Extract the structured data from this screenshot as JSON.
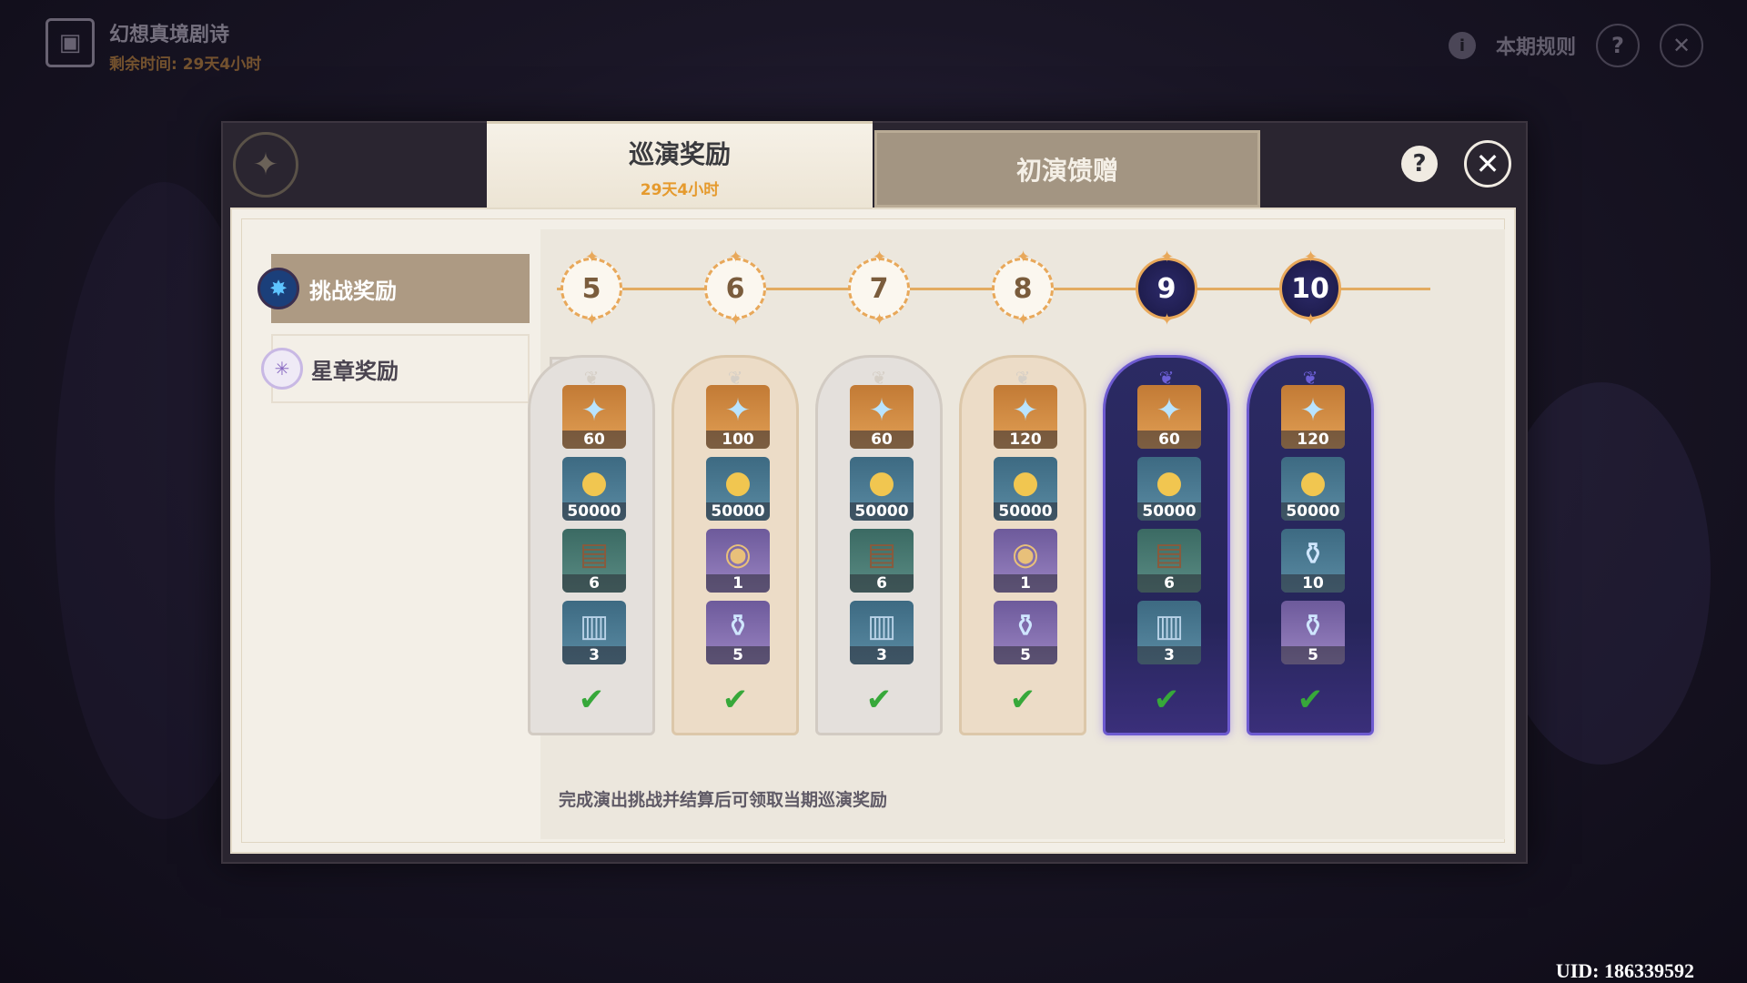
{
  "top_left": {
    "title": "幻想真境剧诗",
    "remaining": "剩余时间: 29天4小时"
  },
  "top_right": {
    "rules_label": "本期规则",
    "info_icon": "i",
    "help_icon": "?",
    "close_icon": "✕"
  },
  "tabs": [
    {
      "label": "巡演奖励",
      "sub": "29天4小时"
    },
    {
      "label": "初演馈赠"
    }
  ],
  "header": {
    "help_icon": "?",
    "close_icon": "✕"
  },
  "sidebar": {
    "items": [
      {
        "label": "挑战奖励",
        "icon": "star-badge-icon"
      },
      {
        "label": "星章奖励",
        "icon": "sparkle-badge-icon"
      }
    ]
  },
  "stages": [
    {
      "num": "5",
      "style": "gray",
      "claimed": true,
      "items": [
        {
          "icon": "crystal-icon",
          "count": "60",
          "bg": "orange"
        },
        {
          "icon": "mora-coin-icon",
          "count": "50000",
          "bg": "teal"
        },
        {
          "icon": "book-icon",
          "count": "6",
          "bg": "green"
        },
        {
          "icon": "chest-icon",
          "count": "3",
          "bg": "teal"
        }
      ]
    },
    {
      "num": "6",
      "style": "tan",
      "claimed": true,
      "items": [
        {
          "icon": "crystal-icon",
          "count": "100",
          "bg": "orange"
        },
        {
          "icon": "mora-coin-icon",
          "count": "50000",
          "bg": "teal"
        },
        {
          "icon": "medal-icon",
          "count": "1",
          "bg": "purple"
        },
        {
          "icon": "potion-icon",
          "count": "5",
          "bg": "purple"
        }
      ]
    },
    {
      "num": "7",
      "style": "gray",
      "claimed": true,
      "items": [
        {
          "icon": "crystal-icon",
          "count": "60",
          "bg": "orange"
        },
        {
          "icon": "mora-coin-icon",
          "count": "50000",
          "bg": "teal"
        },
        {
          "icon": "book-icon",
          "count": "6",
          "bg": "green"
        },
        {
          "icon": "chest-icon",
          "count": "3",
          "bg": "teal"
        }
      ]
    },
    {
      "num": "8",
      "style": "tan",
      "claimed": true,
      "items": [
        {
          "icon": "crystal-icon",
          "count": "120",
          "bg": "orange"
        },
        {
          "icon": "mora-coin-icon",
          "count": "50000",
          "bg": "teal"
        },
        {
          "icon": "medal-icon",
          "count": "1",
          "bg": "purple"
        },
        {
          "icon": "potion-icon",
          "count": "5",
          "bg": "purple"
        }
      ]
    },
    {
      "num": "9",
      "style": "dark",
      "claimed": true,
      "items": [
        {
          "icon": "crystal-icon",
          "count": "60",
          "bg": "orange"
        },
        {
          "icon": "mora-coin-icon",
          "count": "50000",
          "bg": "teal"
        },
        {
          "icon": "book-icon",
          "count": "6",
          "bg": "green"
        },
        {
          "icon": "chest-icon",
          "count": "3",
          "bg": "teal"
        }
      ]
    },
    {
      "num": "10",
      "style": "dark",
      "claimed": true,
      "items": [
        {
          "icon": "crystal-icon",
          "count": "120",
          "bg": "orange"
        },
        {
          "icon": "mora-coin-icon",
          "count": "50000",
          "bg": "teal"
        },
        {
          "icon": "potion-icon",
          "count": "10",
          "bg": "teal"
        },
        {
          "icon": "potion-icon",
          "count": "5",
          "bg": "purple"
        }
      ]
    }
  ],
  "footnote": "完成演出挑战并结算后可领取当期巡演奖励",
  "uid": "UID: 186339592",
  "colors": {
    "accent": "#e8a85a",
    "check": "#37a83a",
    "active_tab_sub": "#e59a2d"
  }
}
